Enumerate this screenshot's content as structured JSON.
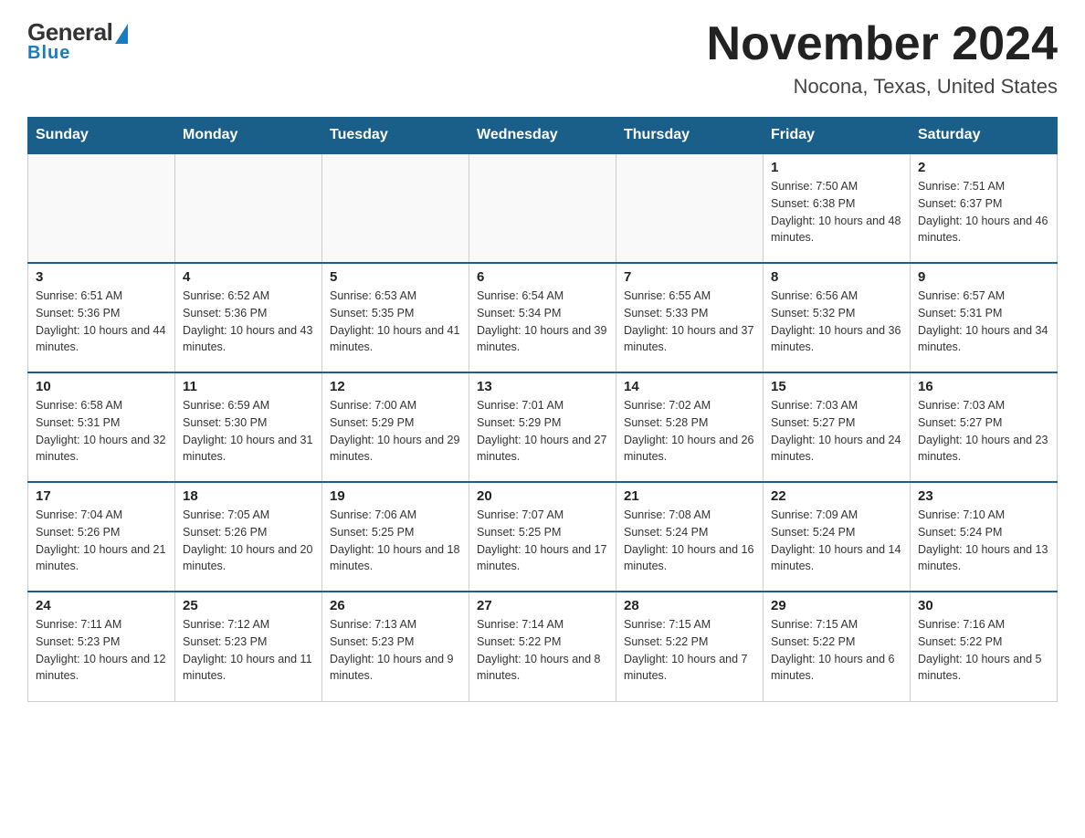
{
  "logo": {
    "general": "General",
    "blue": "Blue"
  },
  "header": {
    "month": "November 2024",
    "location": "Nocona, Texas, United States"
  },
  "weekdays": [
    "Sunday",
    "Monday",
    "Tuesday",
    "Wednesday",
    "Thursday",
    "Friday",
    "Saturday"
  ],
  "weeks": [
    [
      {
        "day": "",
        "info": ""
      },
      {
        "day": "",
        "info": ""
      },
      {
        "day": "",
        "info": ""
      },
      {
        "day": "",
        "info": ""
      },
      {
        "day": "",
        "info": ""
      },
      {
        "day": "1",
        "info": "Sunrise: 7:50 AM\nSunset: 6:38 PM\nDaylight: 10 hours and 48 minutes."
      },
      {
        "day": "2",
        "info": "Sunrise: 7:51 AM\nSunset: 6:37 PM\nDaylight: 10 hours and 46 minutes."
      }
    ],
    [
      {
        "day": "3",
        "info": "Sunrise: 6:51 AM\nSunset: 5:36 PM\nDaylight: 10 hours and 44 minutes."
      },
      {
        "day": "4",
        "info": "Sunrise: 6:52 AM\nSunset: 5:36 PM\nDaylight: 10 hours and 43 minutes."
      },
      {
        "day": "5",
        "info": "Sunrise: 6:53 AM\nSunset: 5:35 PM\nDaylight: 10 hours and 41 minutes."
      },
      {
        "day": "6",
        "info": "Sunrise: 6:54 AM\nSunset: 5:34 PM\nDaylight: 10 hours and 39 minutes."
      },
      {
        "day": "7",
        "info": "Sunrise: 6:55 AM\nSunset: 5:33 PM\nDaylight: 10 hours and 37 minutes."
      },
      {
        "day": "8",
        "info": "Sunrise: 6:56 AM\nSunset: 5:32 PM\nDaylight: 10 hours and 36 minutes."
      },
      {
        "day": "9",
        "info": "Sunrise: 6:57 AM\nSunset: 5:31 PM\nDaylight: 10 hours and 34 minutes."
      }
    ],
    [
      {
        "day": "10",
        "info": "Sunrise: 6:58 AM\nSunset: 5:31 PM\nDaylight: 10 hours and 32 minutes."
      },
      {
        "day": "11",
        "info": "Sunrise: 6:59 AM\nSunset: 5:30 PM\nDaylight: 10 hours and 31 minutes."
      },
      {
        "day": "12",
        "info": "Sunrise: 7:00 AM\nSunset: 5:29 PM\nDaylight: 10 hours and 29 minutes."
      },
      {
        "day": "13",
        "info": "Sunrise: 7:01 AM\nSunset: 5:29 PM\nDaylight: 10 hours and 27 minutes."
      },
      {
        "day": "14",
        "info": "Sunrise: 7:02 AM\nSunset: 5:28 PM\nDaylight: 10 hours and 26 minutes."
      },
      {
        "day": "15",
        "info": "Sunrise: 7:03 AM\nSunset: 5:27 PM\nDaylight: 10 hours and 24 minutes."
      },
      {
        "day": "16",
        "info": "Sunrise: 7:03 AM\nSunset: 5:27 PM\nDaylight: 10 hours and 23 minutes."
      }
    ],
    [
      {
        "day": "17",
        "info": "Sunrise: 7:04 AM\nSunset: 5:26 PM\nDaylight: 10 hours and 21 minutes."
      },
      {
        "day": "18",
        "info": "Sunrise: 7:05 AM\nSunset: 5:26 PM\nDaylight: 10 hours and 20 minutes."
      },
      {
        "day": "19",
        "info": "Sunrise: 7:06 AM\nSunset: 5:25 PM\nDaylight: 10 hours and 18 minutes."
      },
      {
        "day": "20",
        "info": "Sunrise: 7:07 AM\nSunset: 5:25 PM\nDaylight: 10 hours and 17 minutes."
      },
      {
        "day": "21",
        "info": "Sunrise: 7:08 AM\nSunset: 5:24 PM\nDaylight: 10 hours and 16 minutes."
      },
      {
        "day": "22",
        "info": "Sunrise: 7:09 AM\nSunset: 5:24 PM\nDaylight: 10 hours and 14 minutes."
      },
      {
        "day": "23",
        "info": "Sunrise: 7:10 AM\nSunset: 5:24 PM\nDaylight: 10 hours and 13 minutes."
      }
    ],
    [
      {
        "day": "24",
        "info": "Sunrise: 7:11 AM\nSunset: 5:23 PM\nDaylight: 10 hours and 12 minutes."
      },
      {
        "day": "25",
        "info": "Sunrise: 7:12 AM\nSunset: 5:23 PM\nDaylight: 10 hours and 11 minutes."
      },
      {
        "day": "26",
        "info": "Sunrise: 7:13 AM\nSunset: 5:23 PM\nDaylight: 10 hours and 9 minutes."
      },
      {
        "day": "27",
        "info": "Sunrise: 7:14 AM\nSunset: 5:22 PM\nDaylight: 10 hours and 8 minutes."
      },
      {
        "day": "28",
        "info": "Sunrise: 7:15 AM\nSunset: 5:22 PM\nDaylight: 10 hours and 7 minutes."
      },
      {
        "day": "29",
        "info": "Sunrise: 7:15 AM\nSunset: 5:22 PM\nDaylight: 10 hours and 6 minutes."
      },
      {
        "day": "30",
        "info": "Sunrise: 7:16 AM\nSunset: 5:22 PM\nDaylight: 10 hours and 5 minutes."
      }
    ]
  ]
}
